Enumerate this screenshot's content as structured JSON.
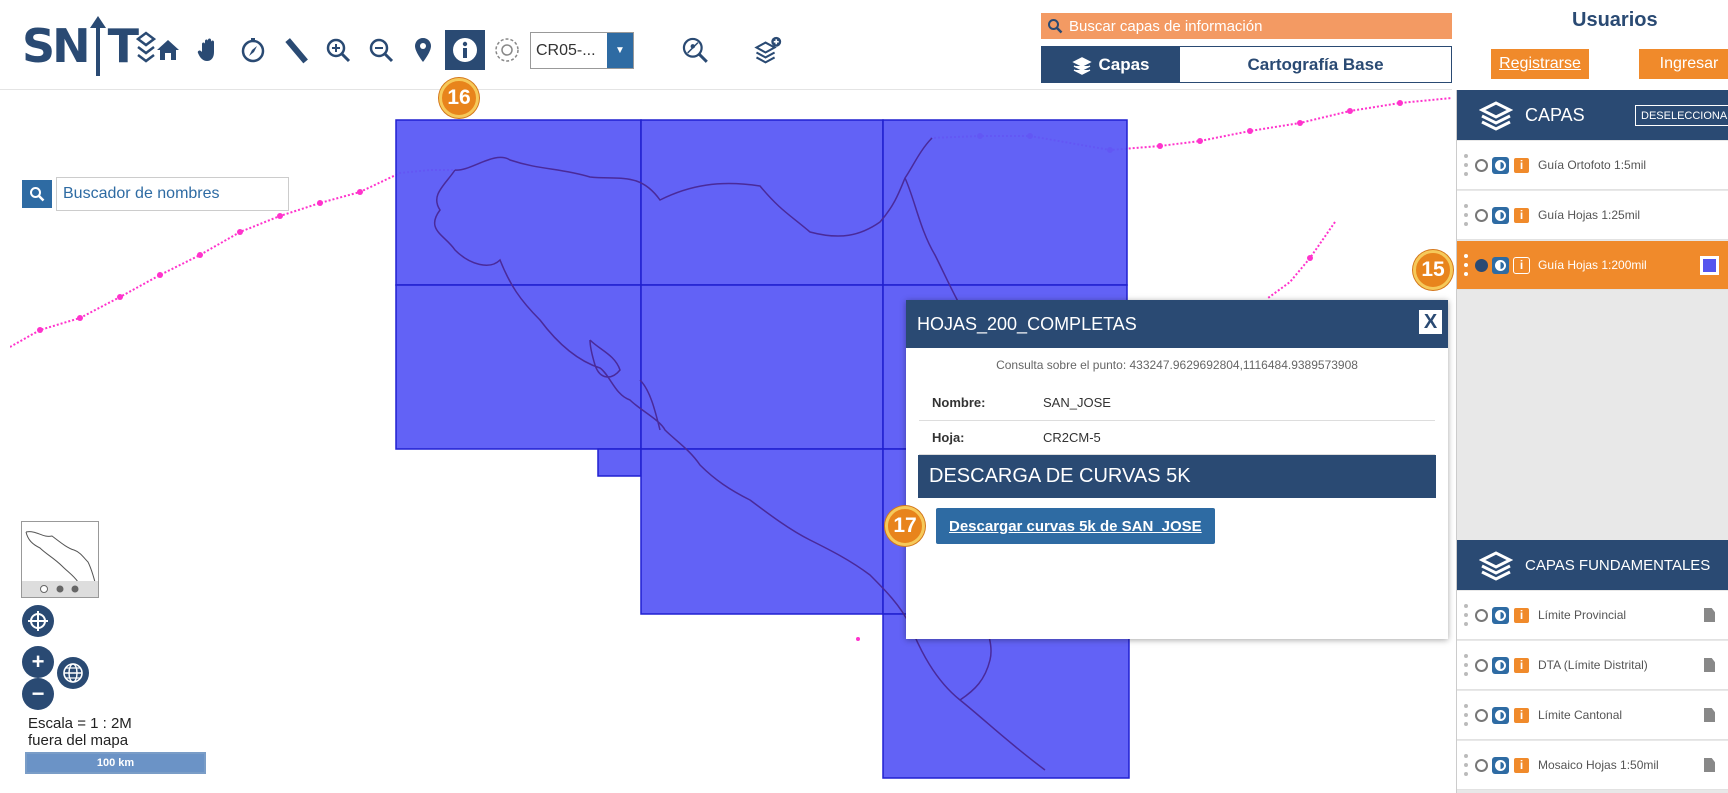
{
  "logo": {
    "left": "SN",
    "right": "T"
  },
  "toolbar": {
    "projection_value": "CR05-...",
    "step_badge_16": "16"
  },
  "search_layers": {
    "placeholder": "Buscar capas de información"
  },
  "tabs": [
    {
      "label": "Capas",
      "active": true
    },
    {
      "label": "Cartografía Base",
      "active": false
    }
  ],
  "users": {
    "title": "Usuarios",
    "register_label": "Registrarse",
    "login_label": "Ingresar"
  },
  "map": {
    "name_search_placeholder": "Buscador de nombres",
    "scale_text": "Escala = 1 : 2M",
    "scale_note": "fuera del mapa",
    "scale_bar_label": "100 km",
    "zoom_in": "+",
    "zoom_out": "−"
  },
  "popup": {
    "title": "HOJAS_200_COMPLETAS",
    "close_label": "X",
    "query_text": "Consulta sobre el punto: 433247.9629692804,1116484.9389573908",
    "fields": [
      {
        "key": "Nombre:",
        "value": "SAN_JOSE"
      },
      {
        "key": "Hoja:",
        "value": "CR2CM-5"
      }
    ],
    "section_title": "DESCARGA DE CURVAS 5K",
    "download_label": "Descargar curvas 5k de SAN_JOSE",
    "step_badge_17": "17"
  },
  "panel": {
    "capas_title": "CAPAS",
    "deselect_label": "DESELECCIONAR",
    "step_badge_15": "15",
    "layers": [
      {
        "label": "Guía Ortofoto 1:5mil",
        "selected": false
      },
      {
        "label": "Guía Hojas 1:25mil",
        "selected": false
      },
      {
        "label": "Guía Hojas 1:200mil",
        "selected": true
      }
    ],
    "fundamental_title": "CAPAS FUNDAMENTALES",
    "fundamental_layers": [
      {
        "label": "Límite Provincial"
      },
      {
        "label": "DTA (Límite Distrital)"
      },
      {
        "label": "Límite Cantonal"
      },
      {
        "label": "Mosaico Hojas 1:50mil"
      }
    ]
  },
  "colors": {
    "navy": "#2a4a73",
    "blue": "#2e6ba3",
    "orange": "#f08a2b",
    "sheet_fill": "#5a5af5",
    "route": "#ff33cc"
  }
}
